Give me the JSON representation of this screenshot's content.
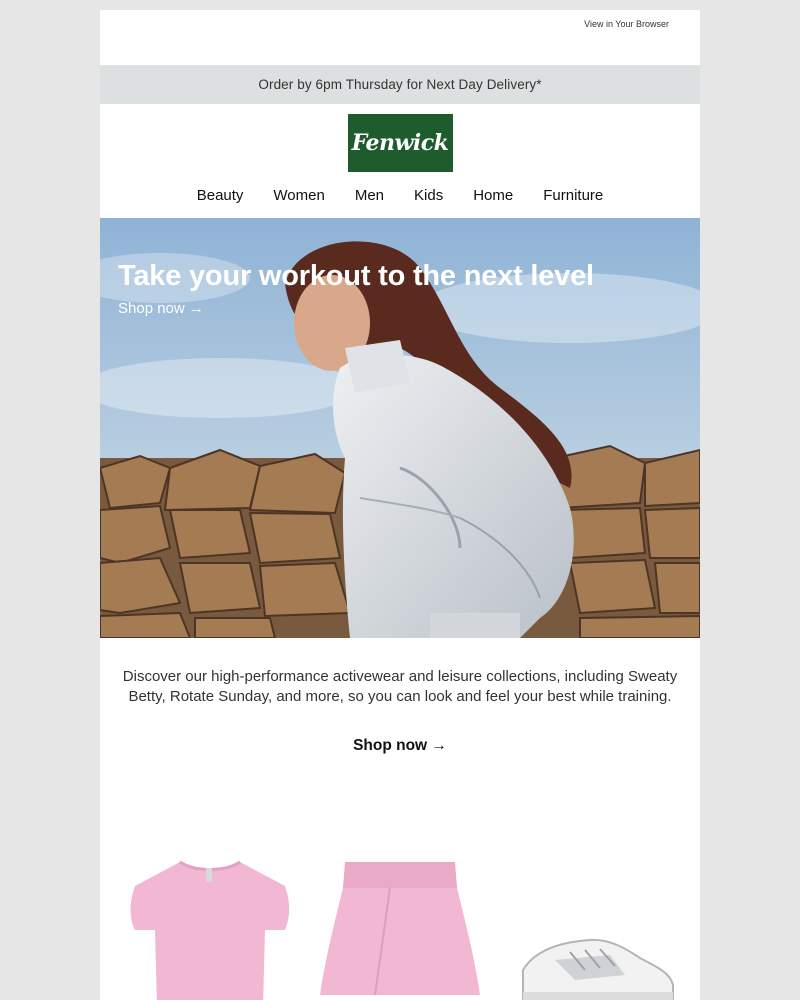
{
  "header": {
    "view_in_browser": "View in Your Browser",
    "delivery_banner": "Order by 6pm Thursday for Next Day Delivery*",
    "logo_text": "Fenwick"
  },
  "nav": {
    "items": [
      "Beauty",
      "Women",
      "Men",
      "Kids",
      "Home",
      "Furniture"
    ]
  },
  "hero": {
    "title": "Take your workout to the next level",
    "link": "Shop now →"
  },
  "intro": {
    "text": "Discover our high-performance activewear and leisure collections, including Sweaty Betty, Rotate Sunday, and more, so you can look and feel your best while training."
  },
  "cta": {
    "label": "Shop now →"
  },
  "products": [
    {
      "icon": "pink-tshirt-image"
    },
    {
      "icon": "pink-skort-image"
    },
    {
      "icon": "white-sneaker-image"
    }
  ],
  "colors": {
    "page_bg": "#e6e6e6",
    "banner_bg": "#dde0e0",
    "brand_green": "#1e5c2e",
    "product_pink": "#f2b8d3"
  }
}
